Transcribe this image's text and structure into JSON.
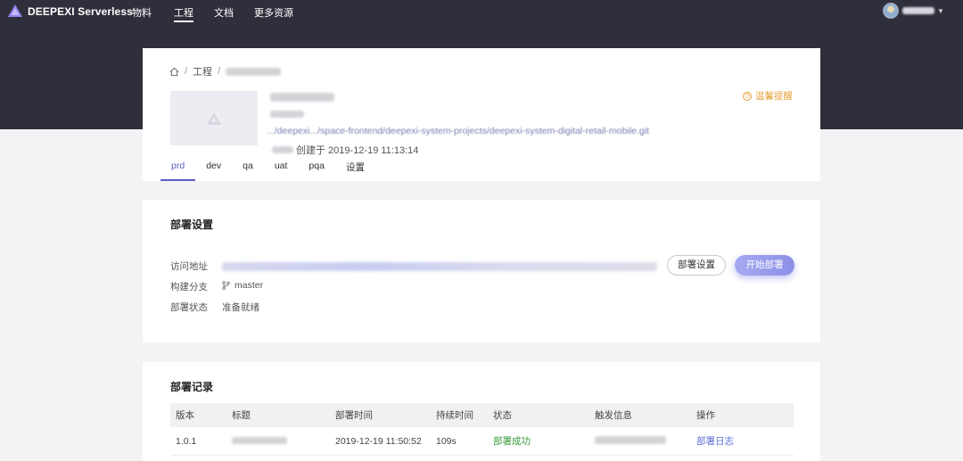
{
  "nav": {
    "brand": "DEEPEXI Serverless",
    "items": [
      "物料",
      "工程",
      "文档",
      "更多资源"
    ],
    "active_index": 1
  },
  "breadcrumb": {
    "separator": "/",
    "project_link": "工程"
  },
  "project": {
    "created_text": "创建于 2019-12-19 11:13:14",
    "repo_url_fragment": ".../deepexi.../space-frontend/deepexi-system-projects/deepexi-system-digital-retail-mobile.git",
    "notice": "温馨提醒"
  },
  "tabs": [
    "prd",
    "dev",
    "qa",
    "uat",
    "pqa",
    "设置"
  ],
  "active_tab": 0,
  "deploy_settings": {
    "title": "部署设置",
    "labels": {
      "url": "访问地址",
      "branch": "构建分支",
      "status": "部署状态"
    },
    "branch": "master",
    "status": "准备就绪",
    "settings_button": "部署设置",
    "start_button": "开始部署"
  },
  "deploy_records": {
    "title": "部署记录",
    "columns": [
      "版本",
      "标题",
      "部署时间",
      "持续时间",
      "状态",
      "触发信息",
      "操作"
    ],
    "rows": [
      {
        "version": "1.0.1",
        "time": "2019-12-19 11:50:52",
        "duration": "109s",
        "status": "部署成功",
        "action": "部署日志"
      }
    ]
  },
  "colors": {
    "topbar": "#2f2f3b",
    "accent": "#5b5fc7",
    "warning": "#e6a23c",
    "success": "#3a9a3a",
    "link": "#5b6ed8"
  }
}
